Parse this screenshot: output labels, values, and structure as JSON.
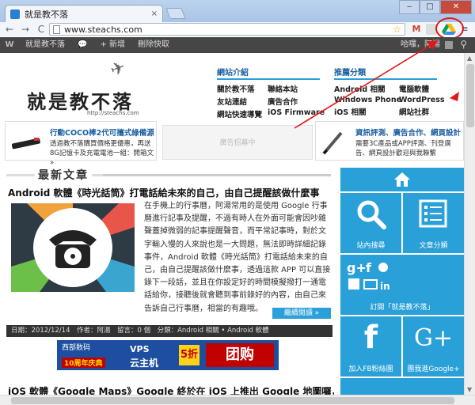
{
  "browser": {
    "tab_title": "就是教不落",
    "tab_close": "×",
    "url": "www.steachs.com",
    "star": "☆",
    "gmail": "M",
    "menu": "≡",
    "back": "←",
    "forward": "→",
    "reload": "C",
    "minimize": "‒",
    "maximize": "□",
    "close": "✕"
  },
  "adminbar": {
    "wp": "W",
    "site": "就是教不落",
    "comments": "💬",
    "add_new": "+ 新增",
    "purge": "刪除快取",
    "greeting": "哈囉，阿湯",
    "search": "⚲"
  },
  "header": {
    "logo": "就是教不落",
    "logo_url": "http://steachs.com",
    "nav_groups": [
      {
        "title": "網站介紹",
        "items": [
          "關於教不落",
          "聯絡本站",
          "友站連結",
          "廣告合作",
          "網站快速導覽",
          "iOS Firmware"
        ]
      },
      {
        "title": "推薦分類",
        "items": [
          "Android 相關",
          "電腦軟體",
          "Windows Phone",
          "WordPress",
          "iOS 相關",
          "網站社群"
        ]
      }
    ]
  },
  "promos": {
    "left_title": "行動COCO棒2代可攜式綠備源",
    "left_text": "透過教不落購買價格更優惠，再送8G記憶卡及充電電池一組：開箱文 »",
    "ad_text": "廣告招募中",
    "right_title": "資訊評測、廣告合作、網頁設計",
    "right_text": "需要3C產品或APP評測、刊登廣告、網頁設計歡迎與我聯繫"
  },
  "main": {
    "section_title": "最新文章",
    "post_title": "Android 軟體《時光話筒》打電話給未來的自己，由自己提醒該做什麼事",
    "post_text": "在手機上的行事曆，阿湯常用的是使用 Google 行事曆進行記事及提醒，不過有時人在外面可能會因吵雜聲蓋掉微弱的記事提醒聲音，而平常記事時，對於文字輸入慢的人來說也是一大問題，無法即時詳細記錄事件，Android 軟體《時光話筒》打電話給未來的自己，由自己提醒該做什麼事，透過這款 APP 可以直接錄下一段話，並且在你設定好的時間模擬撥打一通電話給你，接聽後就會聽到事前錄好的內容，由自己來告訴自己行事曆，相當的有趣哦。",
    "continue": "繼續閱讀 »",
    "meta": "日期：2012/12/14　作者：阿湯　留言：0 個　分類：Android 相關 • Android 軟體",
    "banner": {
      "brand": "西部数码",
      "brand_url": "www.west263.com",
      "anniv": "10周年庆典",
      "vps": "VPS",
      "cloud": "云主机",
      "discount": "5折",
      "group": "团购"
    },
    "post2_title": "iOS 軟體《Google Maps》Google 終於在 iOS 上推出 Google 地圖囉，大家不"
  },
  "sidebar": {
    "home_label": "",
    "search_label": "站內搜尋",
    "category_label": "文章分類",
    "subscribe_label": "訂閱「就是教不落」",
    "fb_label": "加入FB粉絲團",
    "gplus_label": "團我進Google+",
    "fb_glyph": "f",
    "gplus_glyph": "G+"
  },
  "colors": {
    "accent": "#2aa0d8",
    "adminbar": "#464646",
    "annotation": "#e01818"
  }
}
